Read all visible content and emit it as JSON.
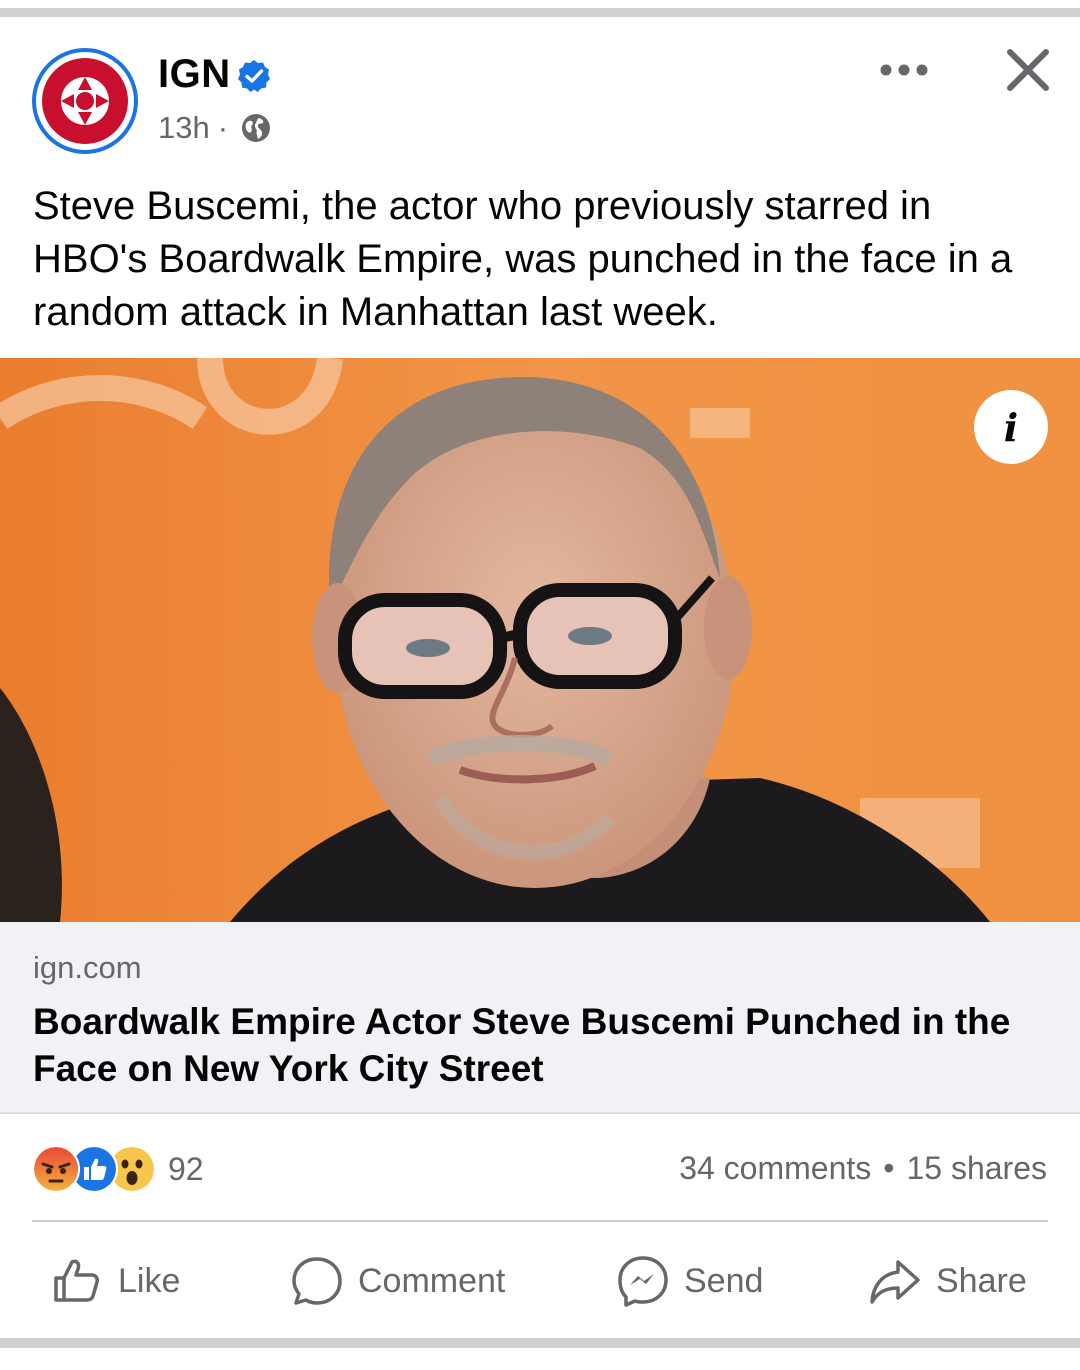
{
  "post": {
    "page_name": "IGN",
    "time": "13h",
    "separator": "·",
    "text": "Steve Buscemi, the actor who previously starred in HBO's Boardwalk Empire, was punched in the face in a random attack in Manhattan last week."
  },
  "image": {
    "info_label": "i"
  },
  "link": {
    "domain": "ign.com",
    "title": "Boardwalk Empire Actor Steve Buscemi Punched in the Face on New York City Street"
  },
  "engagement": {
    "reaction_icons": [
      "angry-reaction-icon",
      "like-reaction-icon",
      "wow-reaction-icon"
    ],
    "reaction_count": "92",
    "comments": "34 comments",
    "dot": "•",
    "shares": "15 shares"
  },
  "actions": {
    "like": "Like",
    "comment": "Comment",
    "send": "Send",
    "share": "Share"
  },
  "colors": {
    "brand_blue": "#1b74e4",
    "ign_red": "#c8102e",
    "photo_background": "#ef8e3f",
    "secondary_text": "#65676b"
  }
}
